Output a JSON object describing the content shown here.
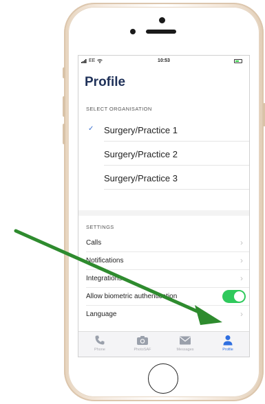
{
  "status_bar": {
    "carrier": "EE",
    "time": "10:53"
  },
  "page": {
    "title": "Profile"
  },
  "organisation": {
    "header": "SELECT ORGANISATION",
    "items": [
      {
        "label": "Surgery/Practice 1",
        "selected": true
      },
      {
        "label": "Surgery/Practice 2",
        "selected": false
      },
      {
        "label": "Surgery/Practice 3",
        "selected": false
      }
    ],
    "check_glyph": "✓"
  },
  "settings": {
    "header": "SETTINGS",
    "items": [
      {
        "label": "Calls"
      },
      {
        "label": "Notifications"
      },
      {
        "label": "Integrations"
      },
      {
        "label": "Allow biometric authentication",
        "toggle": true
      },
      {
        "label": "Language"
      }
    ],
    "chevron_glyph": "›"
  },
  "tab_bar": {
    "tabs": [
      {
        "label": "Phone",
        "icon": "phone-icon",
        "active": false
      },
      {
        "label": "PhotoSAF",
        "icon": "camera-icon",
        "active": false
      },
      {
        "label": "Messages",
        "icon": "envelope-icon",
        "active": false
      },
      {
        "label": "Profile",
        "icon": "person-icon",
        "active": true
      }
    ]
  },
  "colors": {
    "accent_blue": "#2f6fe0",
    "toggle_green": "#2fc95c",
    "annotation_arrow": "#2e8b2e",
    "title_navy": "#1f3159"
  }
}
